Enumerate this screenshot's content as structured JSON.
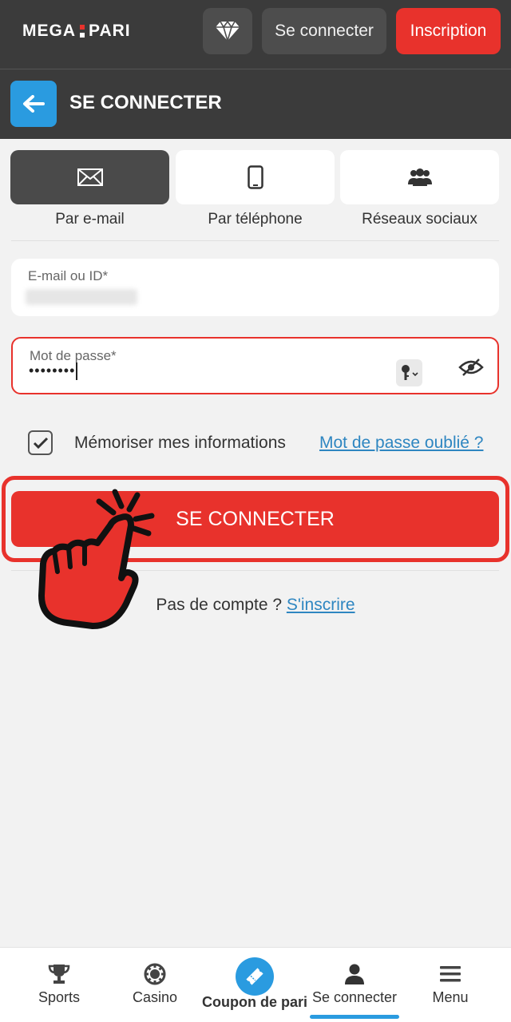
{
  "brand": {
    "logo_left": "MEGA",
    "logo_right": "PARI",
    "accent": "#e8322c",
    "link_color": "#2e86c1",
    "blue": "#2a9be0"
  },
  "topbar": {
    "diamond_icon": "diamond-icon",
    "login_label": "Se connecter",
    "register_label": "Inscription"
  },
  "header": {
    "back_icon": "arrow-left-icon",
    "title": "SE CONNECTER"
  },
  "methods": [
    {
      "label": "Par e-mail",
      "icon": "envelope-icon",
      "active": true
    },
    {
      "label": "Par téléphone",
      "icon": "smartphone-icon",
      "active": false
    },
    {
      "label": "Réseaux sociaux",
      "icon": "users-icon",
      "active": false
    }
  ],
  "form": {
    "email": {
      "label": "E-mail ou ID*"
    },
    "password": {
      "label": "Mot de passe*",
      "value": "••••••••"
    },
    "remember": {
      "label": "Mémoriser mes informations",
      "checked": true
    },
    "forgot_link": "Mot de passe oublié ?",
    "submit_label": "SE CONNECTER"
  },
  "signup": {
    "prompt": "Pas de compte ?",
    "link": "S'inscrire"
  },
  "bottom_nav": [
    {
      "label": "Sports",
      "icon": "trophy-icon"
    },
    {
      "label": "Casino",
      "icon": "casino-chip-icon"
    },
    {
      "label": "Coupon de pari",
      "icon": "ticket-icon"
    },
    {
      "label": "Se connecter",
      "icon": "user-icon",
      "active": true
    },
    {
      "label": "Menu",
      "icon": "hamburger-menu-icon"
    }
  ]
}
